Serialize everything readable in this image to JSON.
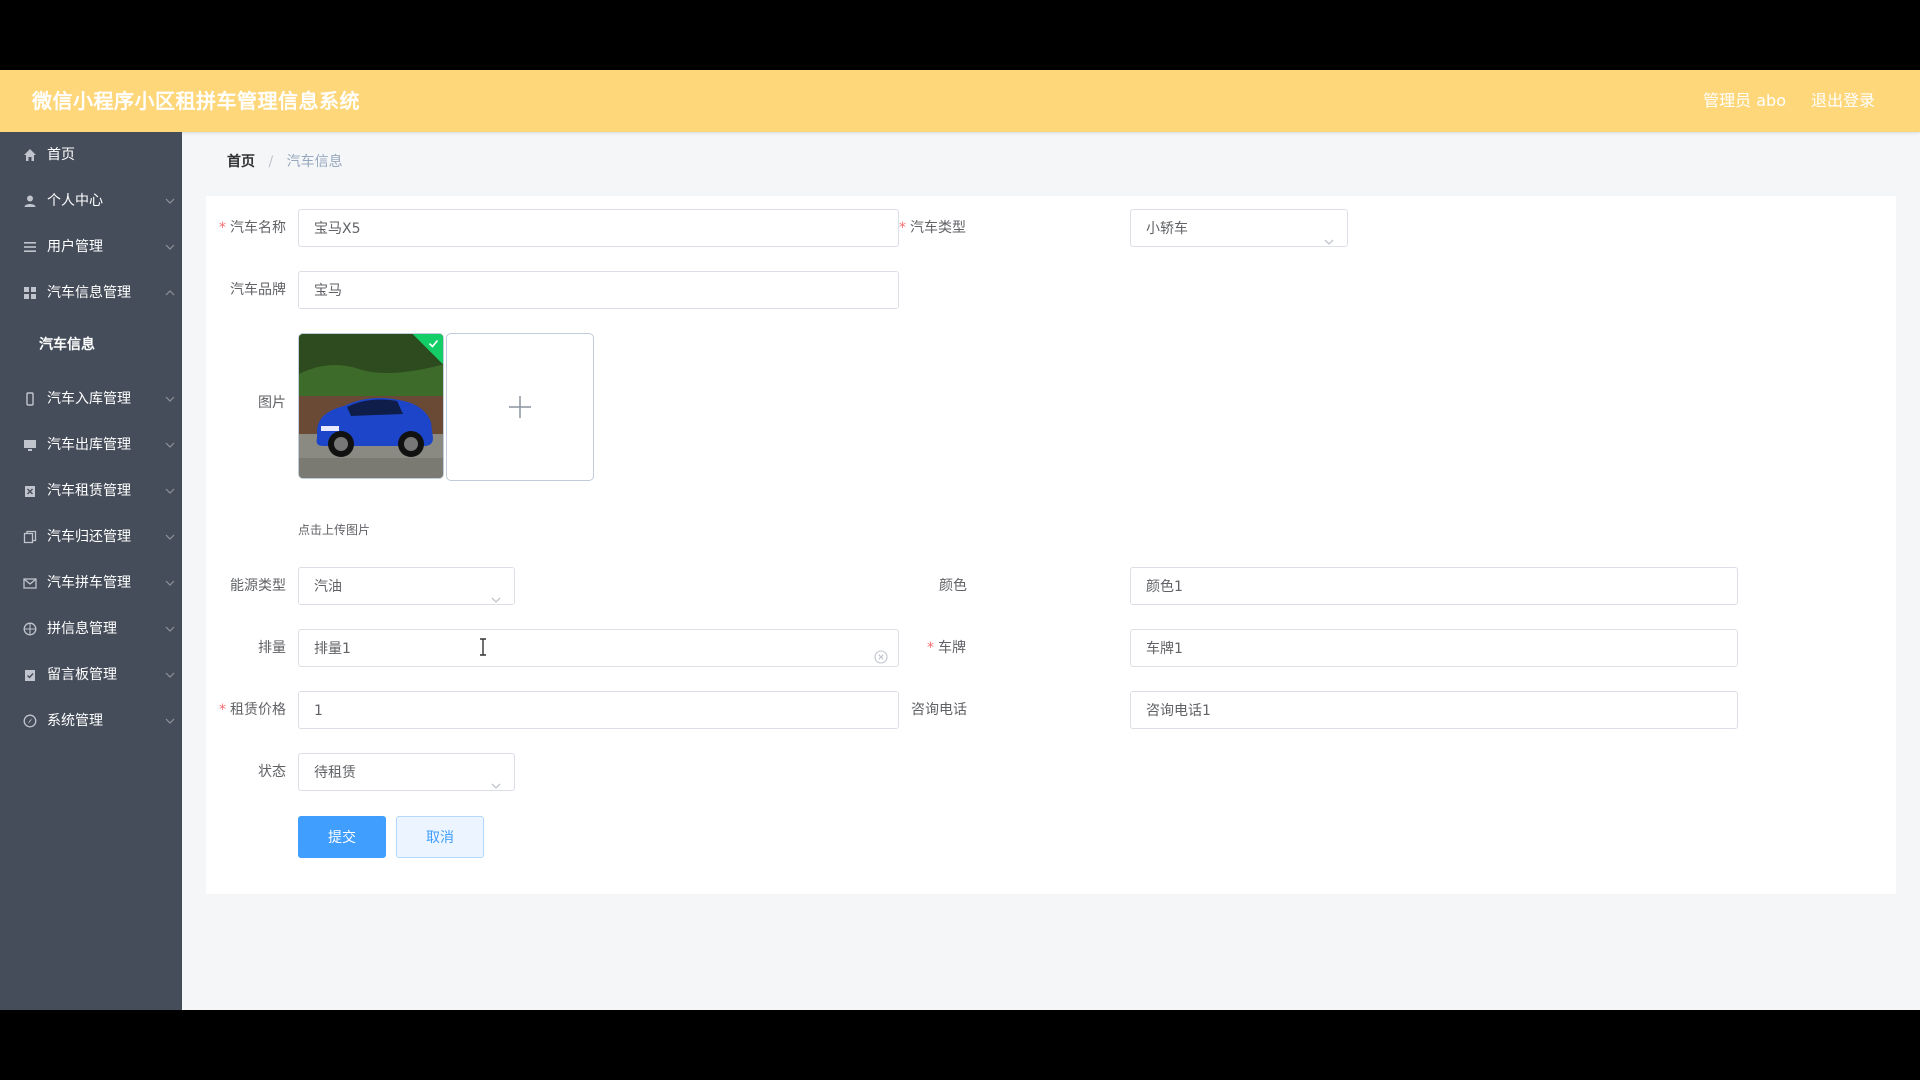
{
  "header": {
    "title": "微信小程序小区租拼车管理信息系统",
    "user": "管理员 abo",
    "logout": "退出登录"
  },
  "sidebar": {
    "items": [
      {
        "label": "首页",
        "icon": "home-icon"
      },
      {
        "label": "个人中心",
        "icon": "user-icon"
      },
      {
        "label": "用户管理",
        "icon": "list-icon"
      },
      {
        "label": "汽车信息管理",
        "icon": "grid-icon"
      },
      {
        "label": "汽车入库管理",
        "icon": "phone-icon"
      },
      {
        "label": "汽车出库管理",
        "icon": "monitor-icon"
      },
      {
        "label": "汽车租赁管理",
        "icon": "clipboard-icon"
      },
      {
        "label": "汽车归还管理",
        "icon": "copy-icon"
      },
      {
        "label": "汽车拼车管理",
        "icon": "mail-icon"
      },
      {
        "label": "拼信息管理",
        "icon": "globe-icon"
      },
      {
        "label": "留言板管理",
        "icon": "note-icon"
      },
      {
        "label": "系统管理",
        "icon": "compass-icon"
      }
    ],
    "active_sub": "汽车信息"
  },
  "breadcrumb": {
    "home": "首页",
    "separator": "/",
    "current": "汽车信息"
  },
  "form": {
    "car_name": {
      "label": "汽车名称",
      "value": "宝马X5"
    },
    "car_type": {
      "label": "汽车类型",
      "value": "小轿车"
    },
    "car_brand": {
      "label": "汽车品牌",
      "value": "宝马"
    },
    "image": {
      "label": "图片",
      "tip": "点击上传图片"
    },
    "energy": {
      "label": "能源类型",
      "value": "汽油"
    },
    "color": {
      "label": "颜色",
      "value": "颜色1"
    },
    "displacement": {
      "label": "排量",
      "value": "排量1"
    },
    "plate": {
      "label": "车牌",
      "value": "车牌1"
    },
    "price": {
      "label": "租赁价格",
      "value": "1"
    },
    "phone": {
      "label": "咨询电话",
      "value": "咨询电话1"
    },
    "status": {
      "label": "状态",
      "value": "待租赁"
    },
    "required_mark": "*",
    "submit": "提交",
    "cancel": "取消"
  },
  "colors": {
    "header": "#fed77b",
    "sidebar": "#454d5a",
    "primary": "#409eff"
  }
}
